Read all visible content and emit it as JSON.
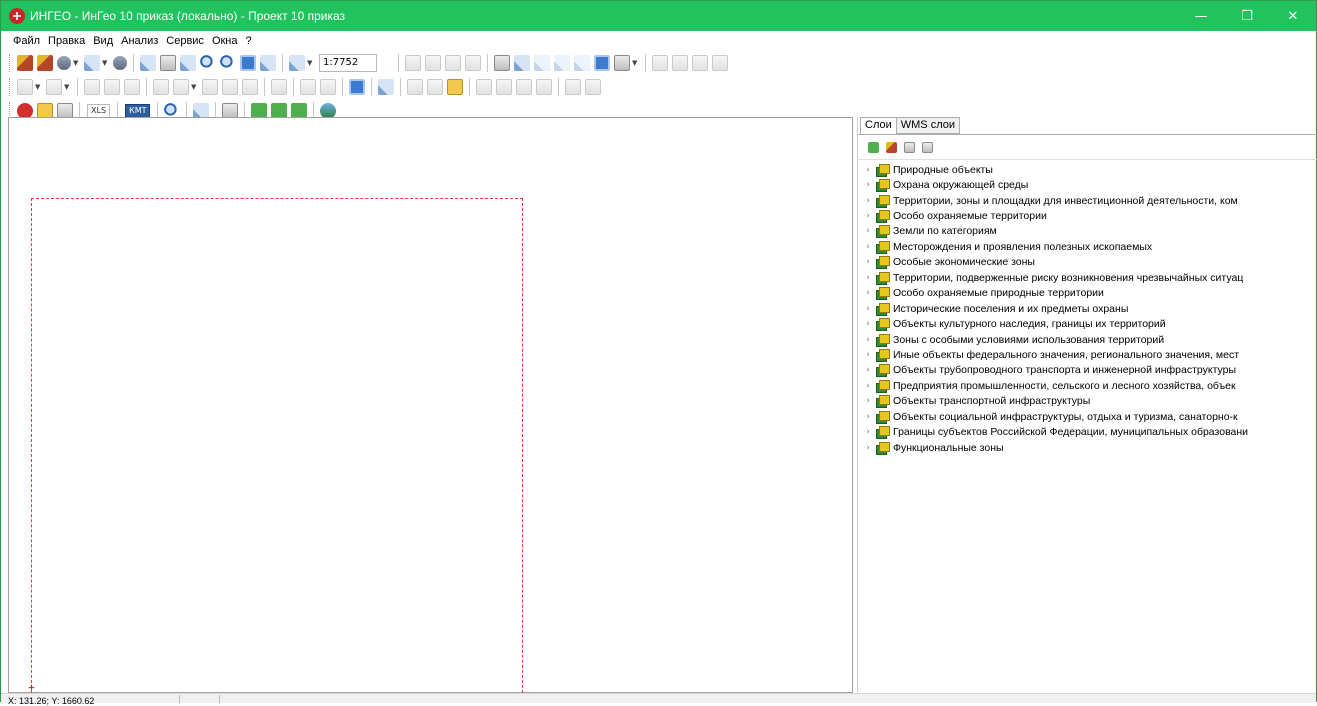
{
  "window": {
    "title": "ИНГЕО - ИнГео 10 приказ (локально) - Проект 10 приказ",
    "controls": {
      "minimize": "—",
      "restore": "❐",
      "close": "✕"
    }
  },
  "menu": [
    "Файл",
    "Правка",
    "Вид",
    "Анализ",
    "Сервис",
    "Окна",
    "?"
  ],
  "toolbar": {
    "scale_value": "1:7752",
    "xls_label": "XLS",
    "kmt_label": "КМТ"
  },
  "panel": {
    "tabs": [
      "Слои",
      "WMS слои"
    ],
    "active_tab": "Слои",
    "layers": [
      "Природные объекты",
      "Охрана окружающей среды",
      "Территории, зоны и площадки для инвестиционной деятельности, ком",
      "Особо охраняемые территории",
      "Земли по категориям",
      "Месторождения и проявления полезных ископаемых",
      "Особые экономические зоны",
      "Территории, подверженные риску возникновения чрезвычайных ситуац",
      "Особо охраняемые природные территории",
      "Исторические поселения и их предметы охраны",
      "Объекты культурного наследия, границы их территорий",
      "Зоны с особыми условиями использования территорий",
      "Иные объекты федерального значения, регионального значения, мест",
      "Объекты трубопроводного транспорта и инженерной инфраструктуры",
      "Предприятия промышленности, сельского и лесного хозяйства, объек",
      "Объекты транспортной инфраструктуры",
      "Объекты социальной инфраструктуры, отдыха и туризма, санаторно-к",
      "Границы субъектов Российской Федерации, муниципальных образовани",
      "Функциональные зоны"
    ]
  },
  "status": {
    "coords": "X: 131.26; Y: 1660.62"
  },
  "colors": {
    "titlebar": "#22c35e",
    "frame": "#e53935"
  }
}
